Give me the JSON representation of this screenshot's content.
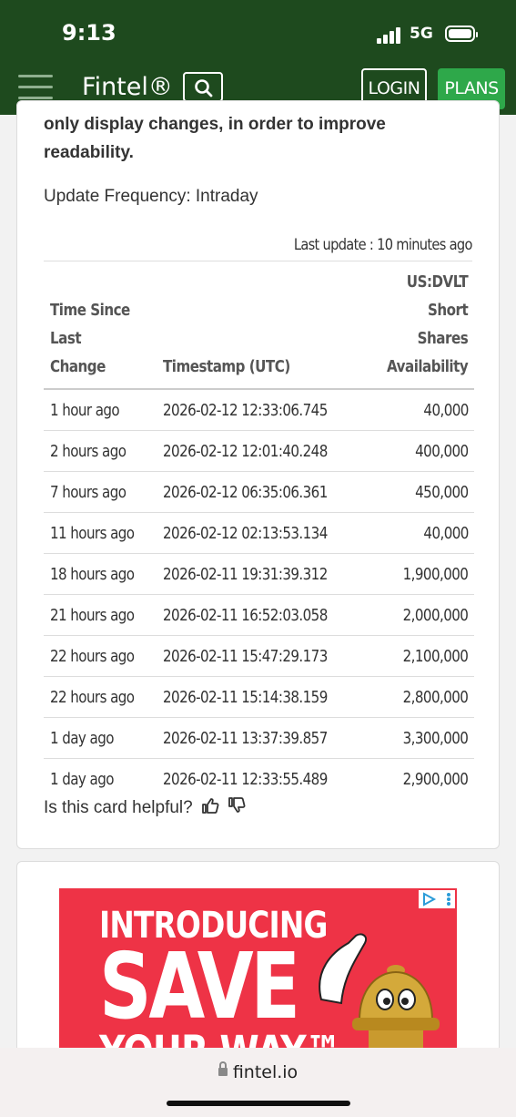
{
  "status_bar": {
    "time": "9:13",
    "network": "5G"
  },
  "header": {
    "brand": "Fintel®",
    "login_label": "LOGIN",
    "plans_label": "PLANS",
    "colors": {
      "header_bg": "#1e4a1e",
      "plans_bg": "#2ea84a"
    }
  },
  "card": {
    "intro_text": "only display changes, in order to improve readability.",
    "update_frequency": "Update Frequency: Intraday",
    "last_update": "Last update : 10 minutes ago",
    "table": {
      "columns": [
        "Time Since Last Change",
        "Timestamp (UTC)",
        "US:DVLT Short Shares Availability"
      ],
      "rows": [
        [
          "1 hour ago",
          "2026-02-12 12:33:06.745",
          "40,000"
        ],
        [
          "2 hours ago",
          "2026-02-12 12:01:40.248",
          "400,000"
        ],
        [
          "7 hours ago",
          "2026-02-12 06:35:06.361",
          "450,000"
        ],
        [
          "11 hours ago",
          "2026-02-12 02:13:53.134",
          "40,000"
        ],
        [
          "18 hours ago",
          "2026-02-11 19:31:39.312",
          "1,900,000"
        ],
        [
          "21 hours ago",
          "2026-02-11 16:52:03.058",
          "2,000,000"
        ],
        [
          "22 hours ago",
          "2026-02-11 15:47:29.173",
          "2,100,000"
        ],
        [
          "22 hours ago",
          "2026-02-11 15:14:38.159",
          "2,800,000"
        ],
        [
          "1 day ago",
          "2026-02-11 13:37:39.857",
          "3,300,000"
        ],
        [
          "1 day ago",
          "2026-02-11 12:33:55.489",
          "2,900,000"
        ]
      ]
    },
    "helpful_prompt": "Is this card helpful?"
  },
  "ad": {
    "line1": "INTRODUCING",
    "line2": "SAVE",
    "line3": "YOUR WAY™",
    "bg_color": "#ee3346"
  },
  "browser": {
    "url": "fintel.io"
  }
}
